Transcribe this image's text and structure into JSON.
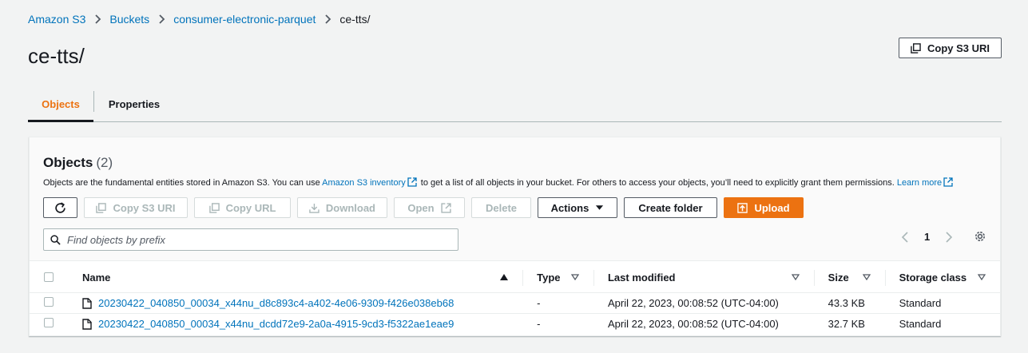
{
  "breadcrumb": {
    "items": [
      "Amazon S3",
      "Buckets",
      "consumer-electronic-parquet",
      "ce-tts/"
    ]
  },
  "page": {
    "title": "ce-tts/",
    "copy_uri_label": "Copy S3 URI"
  },
  "tabs": [
    {
      "label": "Objects",
      "active": true
    },
    {
      "label": "Properties",
      "active": false
    }
  ],
  "objects_panel": {
    "title": "Objects",
    "count": "(2)",
    "description_pre": "Objects are the fundamental entities stored in Amazon S3. You can use ",
    "inventory_link": "Amazon S3 inventory",
    "description_mid": " to get a list of all objects in your bucket. For others to access your objects, you’ll need to explicitly grant them permissions. ",
    "learn_more": "Learn more",
    "toolbar": {
      "copy_s3_uri": "Copy S3 URI",
      "copy_url": "Copy URL",
      "download": "Download",
      "open": "Open",
      "delete": "Delete",
      "actions": "Actions",
      "create_folder": "Create folder",
      "upload": "Upload"
    },
    "search_placeholder": "Find objects by prefix",
    "pagination": {
      "current_page": "1"
    }
  },
  "table": {
    "columns": [
      "Name",
      "Type",
      "Last modified",
      "Size",
      "Storage class"
    ],
    "rows": [
      {
        "name": "20230422_040850_00034_x44nu_d8c893c4-a402-4e06-9309-f426e038eb68",
        "type": "-",
        "last_modified": "April 22, 2023, 00:08:52 (UTC-04:00)",
        "size": "43.3 KB",
        "storage_class": "Standard"
      },
      {
        "name": "20230422_040850_00034_x44nu_dcdd72e9-2a0a-4915-9cd3-f5322ae1eae9",
        "type": "-",
        "last_modified": "April 22, 2023, 00:08:52 (UTC-04:00)",
        "size": "32.7 KB",
        "storage_class": "Standard"
      }
    ]
  },
  "colors": {
    "link": "#0073bb",
    "accent_orange": "#ec7211",
    "text": "#16191f",
    "disabled": "#aab7b8"
  }
}
